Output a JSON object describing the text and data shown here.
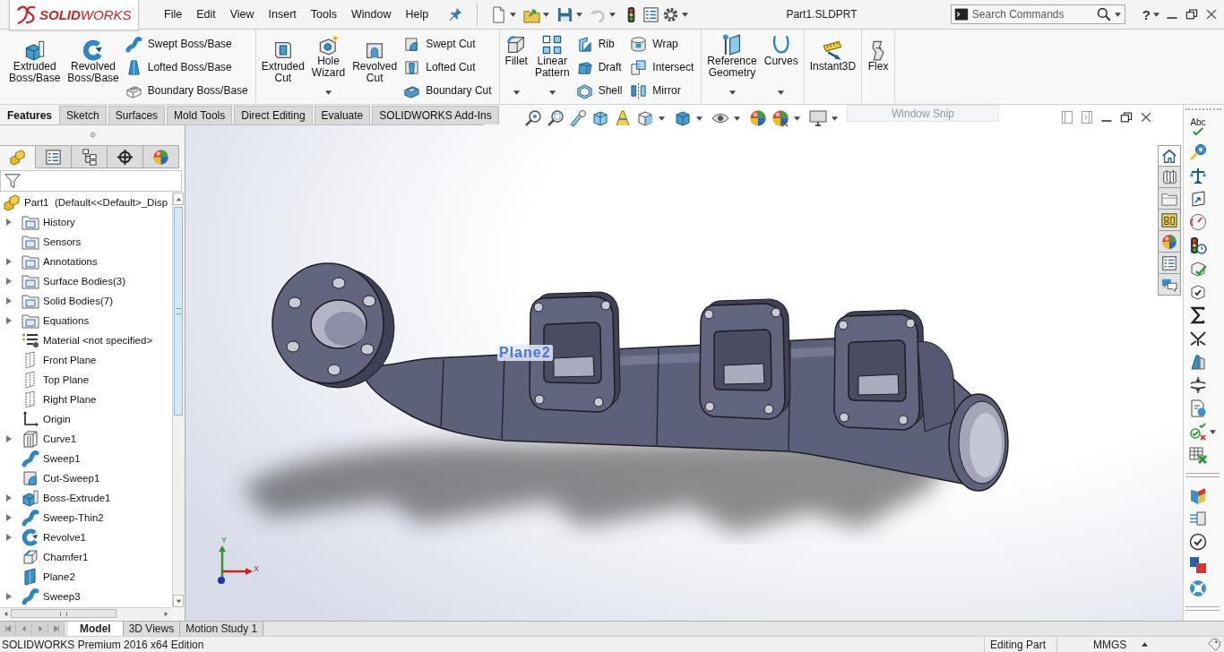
{
  "title_bar": {
    "logo": "**SOLID**WORKS",
    "menus": [
      "File",
      "Edit",
      "View",
      "Insert",
      "Tools",
      "Window",
      "Help"
    ],
    "undo": {
      "disabled": true
    },
    "title": "Part1.SLDPRT",
    "search": {
      "placeholder": "Search Commands"
    },
    "help": "?"
  },
  "ribbon": {
    "groups": [
      {
        "items": [
          {
            "kind": "large",
            "label": "Extruded Boss/Base",
            "dropdown": false
          },
          {
            "kind": "large",
            "label": "Revolved Boss/Base",
            "dropdown": false
          },
          {
            "kind": "stack",
            "items": [
              "Swept Boss/Base",
              "Lofted Boss/Base",
              "Boundary Boss/Base"
            ]
          }
        ]
      },
      {
        "items": [
          {
            "kind": "large",
            "label": "Extruded Cut",
            "dropdown": false
          },
          {
            "kind": "large",
            "label": "Hole Wizard",
            "dropdown": true
          },
          {
            "kind": "large",
            "label": "Revolved Cut",
            "dropdown": false
          },
          {
            "kind": "stack",
            "items": [
              "Swept Cut",
              "Lofted Cut",
              "Boundary Cut"
            ]
          }
        ]
      },
      {
        "items": [
          {
            "kind": "large",
            "label": "Fillet",
            "dropdown": true
          },
          {
            "kind": "large",
            "label": "Linear Pattern",
            "dropdown": true
          },
          {
            "kind": "stack",
            "items": [
              "Rib",
              "Draft",
              "Shell"
            ]
          },
          {
            "kind": "stack",
            "items": [
              "Wrap",
              "Intersect",
              "Mirror"
            ]
          }
        ]
      },
      {
        "items": [
          {
            "kind": "large",
            "label": "Reference Geometry",
            "dropdown": true
          },
          {
            "kind": "large",
            "label": "Curves",
            "dropdown": true
          }
        ]
      },
      {
        "items": [
          {
            "kind": "large",
            "label": "Instant3D",
            "dropdown": false
          }
        ]
      },
      {
        "items": [
          {
            "kind": "large",
            "label": "Flex",
            "dropdown": false
          }
        ]
      }
    ]
  },
  "command_tabs": [
    {
      "label": "Features",
      "selected": true
    },
    {
      "label": "Sketch",
      "selected": false
    },
    {
      "label": "Surfaces",
      "selected": false
    },
    {
      "label": "Mold Tools",
      "selected": false
    },
    {
      "label": "Direct Editing",
      "selected": false
    },
    {
      "label": "Evaluate",
      "selected": false
    },
    {
      "label": "SOLIDWORKS Add-Ins",
      "selected": false
    }
  ],
  "window_snip": "Window Snip",
  "feature_manager": {
    "tabs": [
      {
        "selected": true
      },
      {
        "selected": false
      },
      {
        "selected": false
      },
      {
        "selected": false
      },
      {
        "selected": false
      }
    ],
    "tree": {
      "label": "Part1  (Default<<Default>_Disp",
      "kind": "part",
      "children": [
        {
          "label": "History",
          "kind": "folder",
          "expandable": true
        },
        {
          "label": "Sensors",
          "kind": "folder",
          "expandable": false
        },
        {
          "label": "Annotations",
          "kind": "folder",
          "expandable": true
        },
        {
          "label": "Surface Bodies(3)",
          "kind": "folder",
          "expandable": true
        },
        {
          "label": "Solid Bodies(7)",
          "kind": "folder",
          "expandable": true
        },
        {
          "label": "Equations",
          "kind": "folder",
          "expandable": true
        },
        {
          "label": "Material <not specified>",
          "kind": "material",
          "expandable": false
        },
        {
          "label": "Front Plane",
          "kind": "plane",
          "expandable": false
        },
        {
          "label": "Top Plane",
          "kind": "plane",
          "expandable": false
        },
        {
          "label": "Right Plane",
          "kind": "plane",
          "expandable": false
        },
        {
          "label": "Origin",
          "kind": "origin",
          "expandable": false
        },
        {
          "label": "Curve1",
          "kind": "curve",
          "expandable": true
        },
        {
          "label": "Sweep1",
          "kind": "sweep",
          "expandable": false
        },
        {
          "label": "Cut-Sweep1",
          "kind": "cut_sweep",
          "expandable": false
        },
        {
          "label": "Boss-Extrude1",
          "kind": "extrude",
          "expandable": true
        },
        {
          "label": "Sweep-Thin2",
          "kind": "sweep",
          "expandable": true
        },
        {
          "label": "Revolve1",
          "kind": "revolve",
          "expandable": true
        },
        {
          "label": "Chamfer1",
          "kind": "chamfer",
          "expandable": false
        },
        {
          "label": "Plane2",
          "kind": "ref_plane",
          "expandable": false
        },
        {
          "label": "Sweep3",
          "kind": "sweep",
          "expandable": true
        }
      ]
    }
  },
  "viewport": {
    "plane_label": "Plane2",
    "triad_labels": [
      "Y",
      "X"
    ]
  },
  "task_pane_tabs": [
    {
      "selected": true
    },
    {
      "selected": false
    },
    {
      "selected": false
    },
    {
      "selected": false
    },
    {
      "selected": false
    },
    {
      "selected": false
    },
    {
      "selected": false
    }
  ],
  "right_toolbar": {
    "spell_check": "Abc"
  },
  "bottom_tabs": [
    {
      "label": "Model",
      "selected": true
    },
    {
      "label": "3D Views",
      "selected": false
    },
    {
      "label": "Motion Study 1",
      "selected": false
    }
  ],
  "status_bar": {
    "edition": "SOLIDWORKS Premium 2016 x64 Edition",
    "mode": "Editing Part",
    "units": "MMGS"
  }
}
